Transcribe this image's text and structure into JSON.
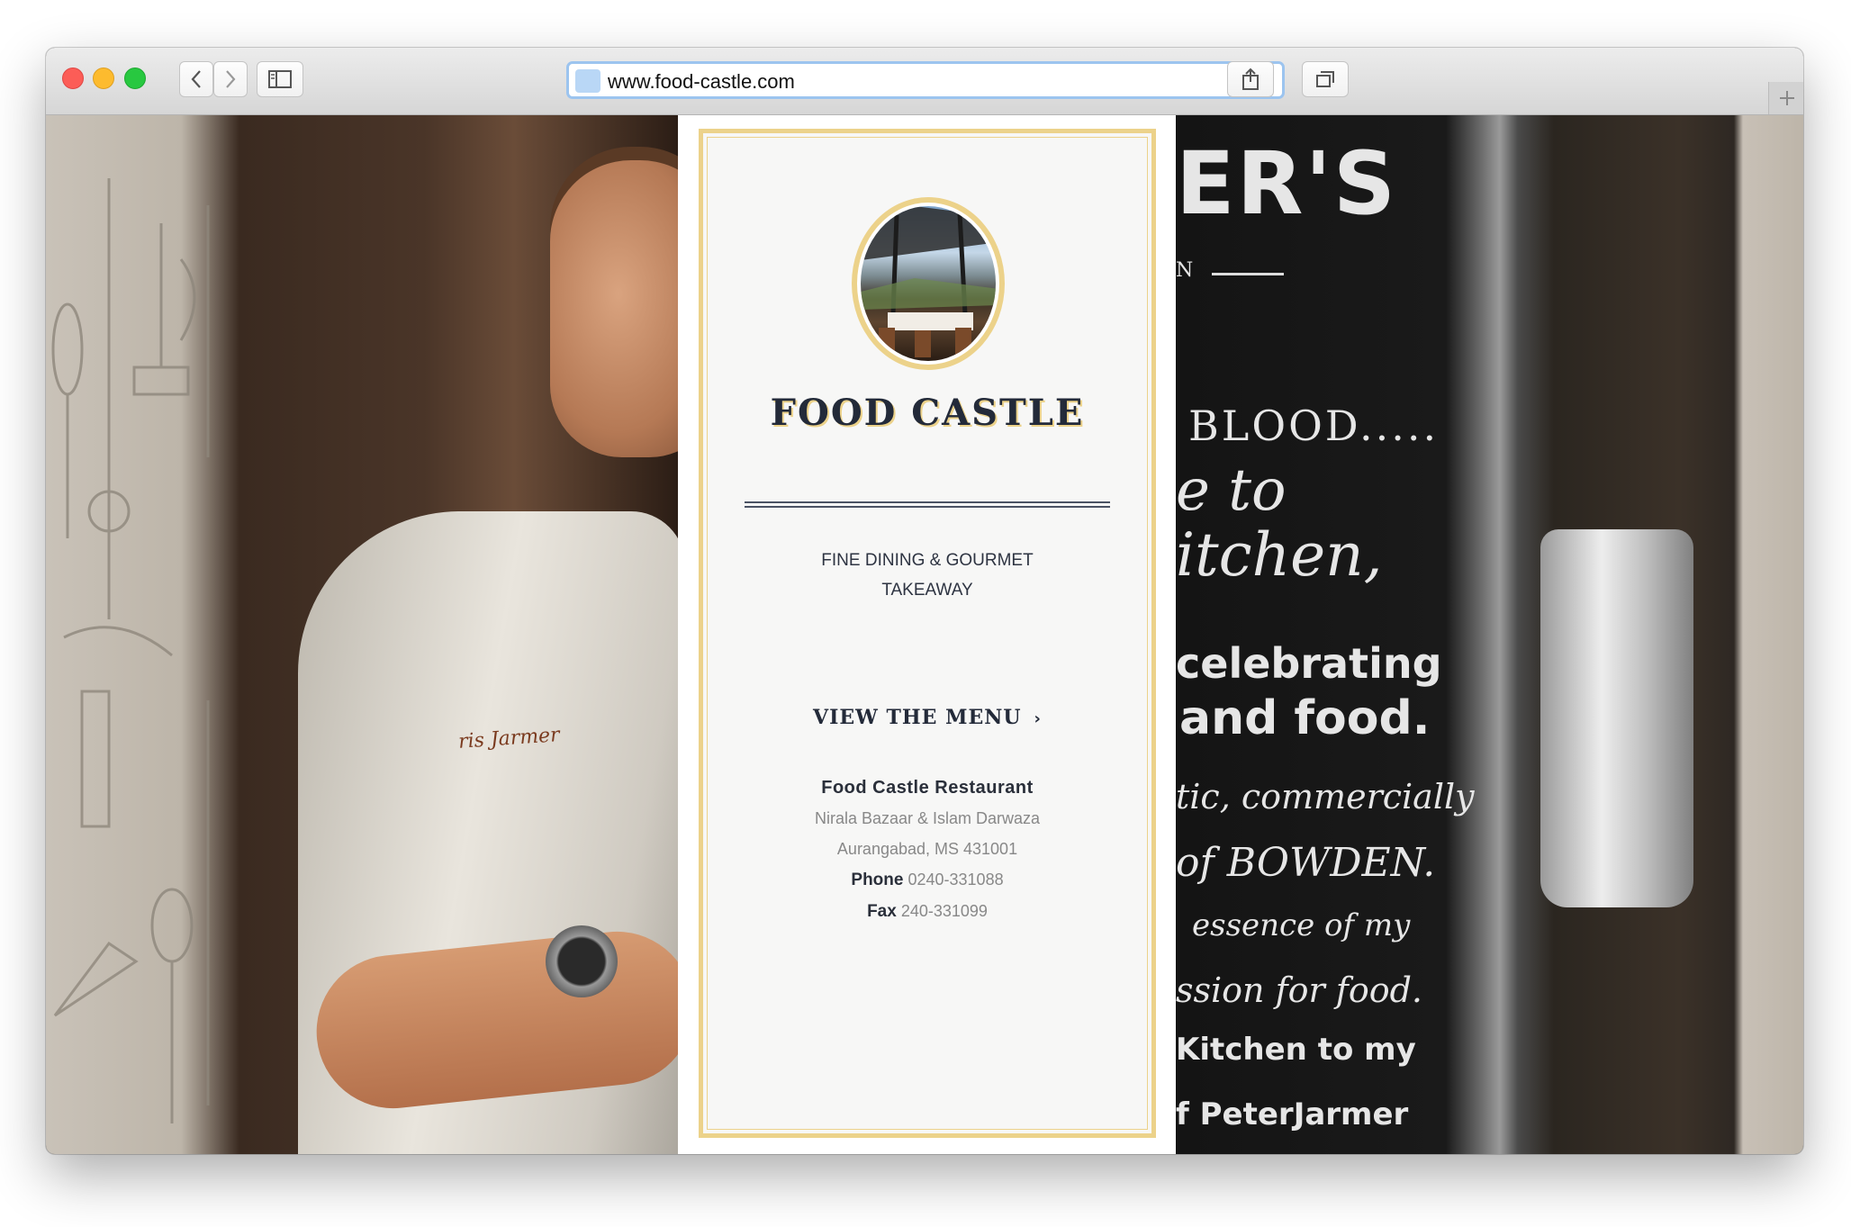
{
  "browser": {
    "url": "www.food-castle.com",
    "buttons": {
      "back": "chevron-left-icon",
      "forward": "chevron-right-icon",
      "sidebar": "sidebar-icon",
      "reload": "reload-icon",
      "share": "share-icon",
      "tabs": "tabs-icon",
      "new_tab": "plus-icon"
    }
  },
  "card": {
    "brand": "FOOD CASTLE",
    "tagline": [
      "FINE DINING & GOURMET",
      "TAKEAWAY"
    ],
    "view_menu": "VIEW THE MENU",
    "view_menu_chevron": "›",
    "restaurant_name": "Food Castle Restaurant",
    "address_line1": "Nirala Bazaar & Islam Darwaza",
    "address_line2": "Aurangabad, MS 431001",
    "phone_label": "Phone",
    "phone_value": "0240-331088",
    "fax_label": "Fax",
    "fax_value": "240-331099"
  },
  "background": {
    "embroidery": "ris Jarmer",
    "chalkboard": {
      "heading": "ER'S",
      "subline": "N",
      "lines": [
        "BLOOD.....",
        "e to",
        "itchen,",
        "celebrating",
        "and food.",
        "tic, commercially",
        "of  BOWDEN.",
        "essence  of  my",
        "ssion  for  food.",
        "Kitchen  to  my",
        "f PeterJarmer"
      ]
    }
  },
  "colors": {
    "accent_gold": "#ecd28a",
    "brand_navy": "#232a39",
    "url_focus": "#9cc4ef"
  }
}
